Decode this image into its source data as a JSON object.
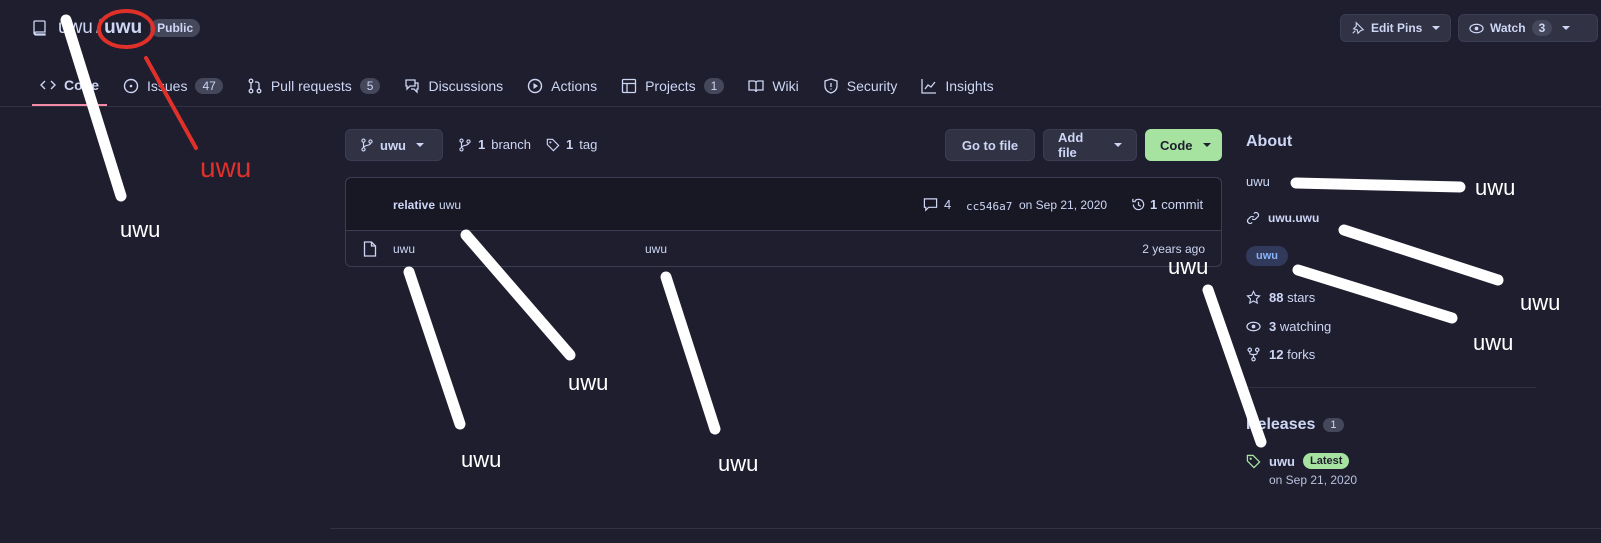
{
  "header": {
    "owner": "uwu",
    "separator": "/",
    "repo": "uwu",
    "visibility": "Public",
    "edit_pins_label": "Edit Pins",
    "watch_label": "Watch",
    "watch_count": "3"
  },
  "tabs": [
    {
      "label": "Code",
      "count": null
    },
    {
      "label": "Issues",
      "count": "47"
    },
    {
      "label": "Pull requests",
      "count": "5"
    },
    {
      "label": "Discussions",
      "count": null
    },
    {
      "label": "Actions",
      "count": null
    },
    {
      "label": "Projects",
      "count": "1"
    },
    {
      "label": "Wiki",
      "count": null
    },
    {
      "label": "Security",
      "count": null
    },
    {
      "label": "Insights",
      "count": null
    }
  ],
  "controls": {
    "branch_select": "uwu",
    "branch_count": "1",
    "branch_label": "branch",
    "tag_count": "1",
    "tag_label": "tag",
    "go_to_file": "Go to file",
    "add_file": "Add file",
    "code": "Code"
  },
  "commit": {
    "author": "relative",
    "message": "uwu",
    "comments": "4",
    "hash": "cc546a7",
    "date": "on Sep 21, 2020",
    "commit_count": "1",
    "commit_label": "commit"
  },
  "files": [
    {
      "name": "uwu",
      "message": "uwu",
      "age": "2 years ago"
    }
  ],
  "about": {
    "heading": "About",
    "description": "uwu",
    "link": "uwu.uwu",
    "topic": "uwu",
    "stars_count": "88",
    "stars_label": "stars",
    "watching_count": "3",
    "watching_label": "watching",
    "forks_count": "12",
    "forks_label": "forks"
  },
  "releases": {
    "heading": "Releases",
    "count": "1",
    "name": "uwu",
    "badge": "Latest",
    "date": "on Sep 21, 2020"
  },
  "annotations": {
    "a1": "uwu",
    "a2": "uwu",
    "a3": "uwu",
    "a4": "uwu",
    "a5": "uwu",
    "a6": "uwu",
    "a7": "uwu",
    "a8": "uwu",
    "a9": "uwu",
    "a10": "uwu"
  },
  "colors": {
    "background": "#1e1e2e",
    "accent_tab": "#f38ba8",
    "green_button": "#a6e3a1",
    "scribble": "#ffffff",
    "red_scribble": "#e0302a"
  }
}
